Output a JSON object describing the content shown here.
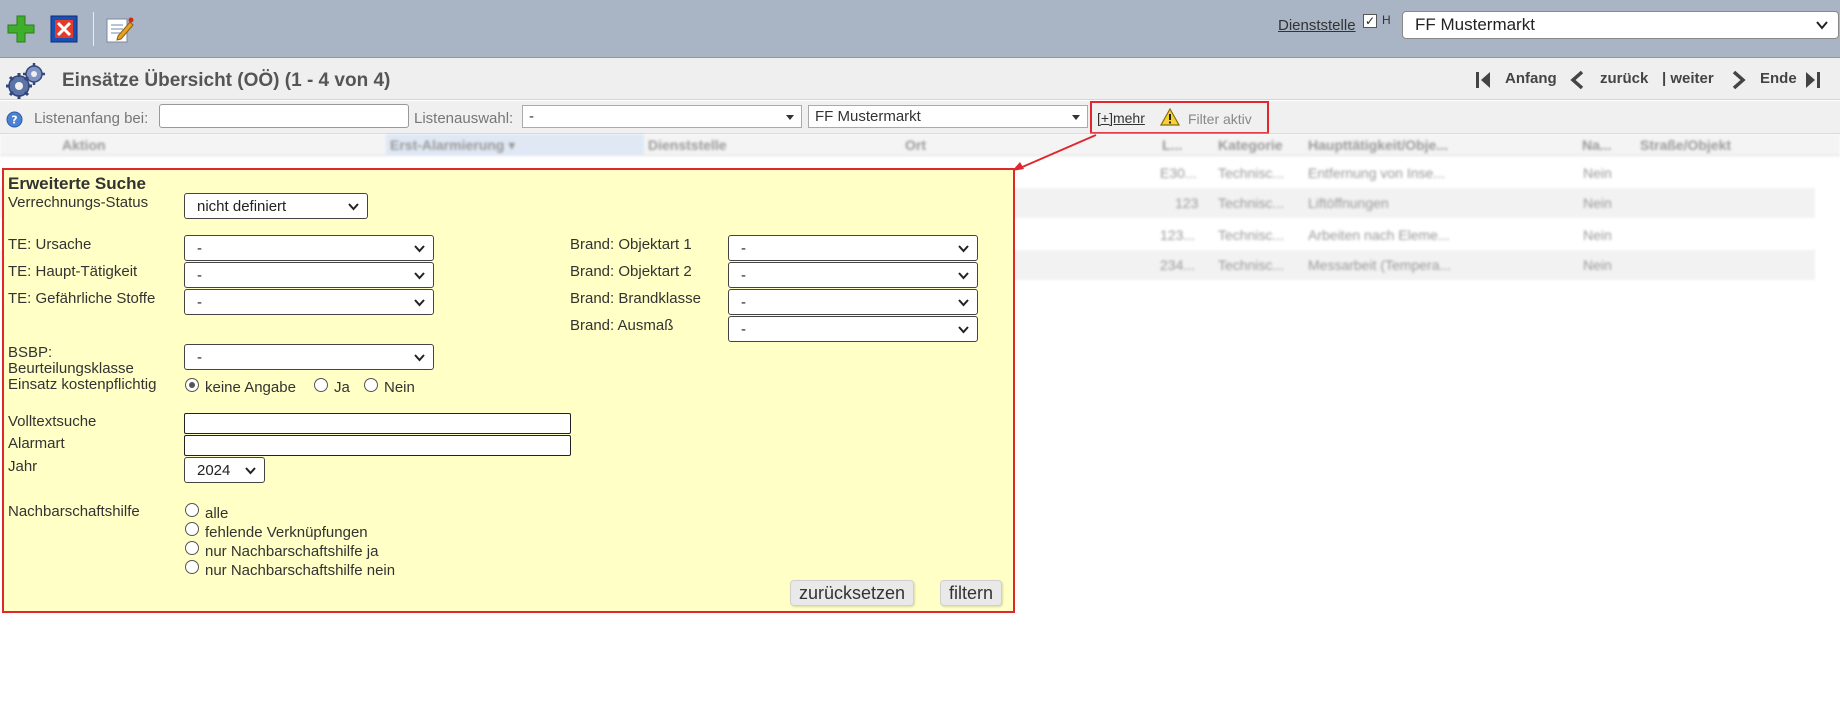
{
  "toolbar": {
    "dienststelle_label": "Dienststelle",
    "dienststelle_checked": "✓",
    "dienststelle_h": "H",
    "dienststelle_value": "FF Mustermarkt"
  },
  "title": {
    "text": "Einsätze Übersicht (OÖ) (1 - 4 von 4)",
    "pager": {
      "first": "Anfang",
      "prev": "zurück",
      "next": "| weiter",
      "last": "Ende"
    }
  },
  "filter_row": {
    "start_label": "Listenanfang bei:",
    "start_value": "",
    "list_label": "Listenauswahl:",
    "list_value": "-",
    "unit_value": "FF Mustermarkt",
    "mehr": "[+]mehr",
    "filter_status": "Filter aktiv"
  },
  "table": {
    "columns": [
      "Aktion",
      "Erst-Alarmierung ▾",
      "Dienststelle",
      "Ort",
      "L...",
      "Kategorie",
      "Haupttätigkeit/Obje...",
      "Na...",
      "Straße/Objekt"
    ],
    "rows": [
      {
        "nr": "E30...",
        "kategorie": "Technisc...",
        "taetigkeit": "Entfernung von Inse...",
        "na": "Nein"
      },
      {
        "nr": "123",
        "kategorie": "Technisc...",
        "taetigkeit": "Liftöffnungen",
        "na": "Nein"
      },
      {
        "nr": "123...",
        "kategorie": "Technisc...",
        "taetigkeit": "Arbeiten nach Eleme...",
        "na": "Nein"
      },
      {
        "nr": "234...",
        "kategorie": "Technisc...",
        "taetigkeit": "Messarbeit (Tempera...",
        "na": "Nein"
      }
    ]
  },
  "panel": {
    "title": "Erweiterte Suche",
    "verrechnung_label": "Verrechnungs-Status",
    "verrechnung_value": "nicht definiert",
    "te_ursache_label": "TE: Ursache",
    "te_ursache_value": "-",
    "te_haupt_label": "TE: Haupt-Tätigkeit",
    "te_haupt_value": "-",
    "te_stoffe_label": "TE: Gefährliche Stoffe",
    "te_stoffe_value": "-",
    "brand_obj1_label": "Brand: Objektart 1",
    "brand_obj1_value": "-",
    "brand_obj2_label": "Brand: Objektart 2",
    "brand_obj2_value": "-",
    "brand_klasse_label": "Brand: Brandklasse",
    "brand_klasse_value": "-",
    "brand_ausmass_label": "Brand: Ausmaß",
    "brand_ausmass_value": "-",
    "bsbp_label_1": "BSBP:",
    "bsbp_label_2": "Beurteilungsklasse",
    "bsbp_value": "-",
    "kosten_label": "Einsatz kostenpflichtig",
    "kosten_options": [
      "keine Angabe",
      "Ja",
      "Nein"
    ],
    "volltext_label": "Volltextsuche",
    "volltext_value": "",
    "alarmart_label": "Alarmart",
    "alarmart_value": "",
    "jahr_label": "Jahr",
    "jahr_value": "2024",
    "nachbar_label": "Nachbarschaftshilfe",
    "nachbar_options": [
      "alle",
      "fehlende Verknüpfungen",
      "nur Nachbarschaftshilfe ja",
      "nur Nachbarschaftshilfe nein"
    ],
    "reset_label": "zurücksetzen",
    "filter_label": "filtern"
  },
  "colors": {
    "toolbar": "#a9b4c4",
    "panel": "#ffffc6",
    "highlight": "#e0262e"
  }
}
